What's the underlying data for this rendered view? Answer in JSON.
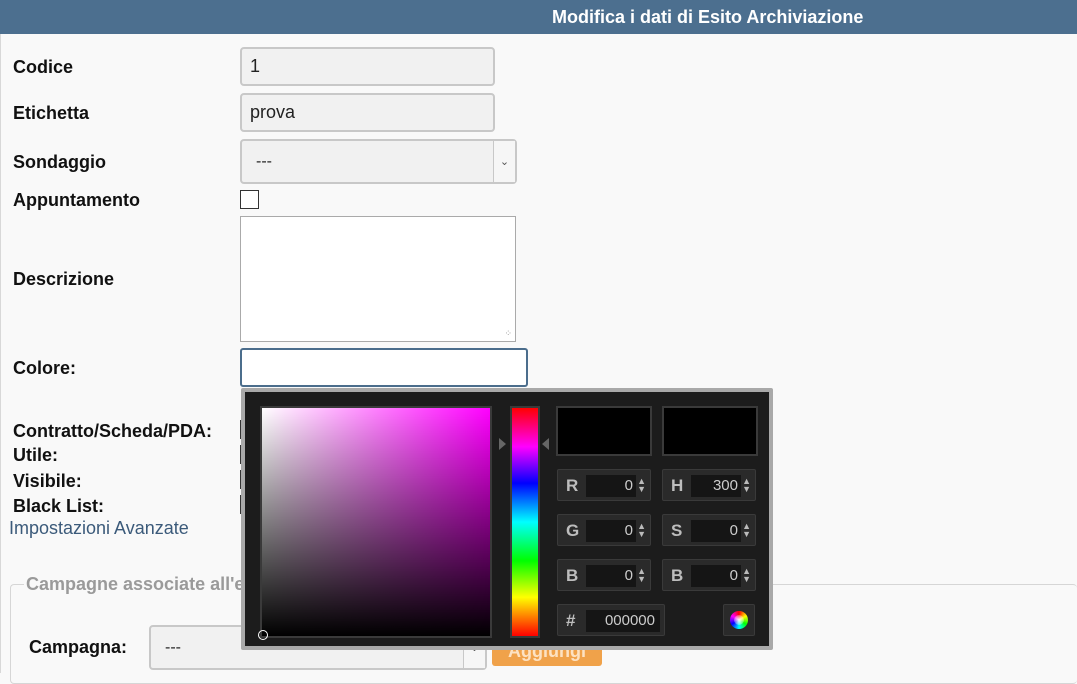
{
  "header": {
    "title": "Modifica i dati di Esito Archiviazione"
  },
  "form": {
    "codice": {
      "label": "Codice",
      "value": "1"
    },
    "etichetta": {
      "label": "Etichetta",
      "value": "prova"
    },
    "sondaggio": {
      "label": "Sondaggio",
      "selected": "---"
    },
    "appuntamento": {
      "label": "Appuntamento",
      "checked": false
    },
    "descrizione": {
      "label": "Descrizione",
      "value": ""
    },
    "colore": {
      "label": "Colore:",
      "value": ""
    },
    "contratto": {
      "label": "Contratto/Scheda/PDA:"
    },
    "utile": {
      "label": "Utile:"
    },
    "visibile": {
      "label": "Visibile:"
    },
    "black_list": {
      "label": "Black List:"
    }
  },
  "advanced_link": "Impostazioni Avanzate",
  "campaigns": {
    "legend": "Campagne associate all'e",
    "campaign_label": "Campagna:",
    "campaign_selected": "---",
    "add_button": "Aggiungi"
  },
  "color_picker": {
    "hue_color": "#ff00ff",
    "current_color": "#000000",
    "r": {
      "label": "R",
      "value": "0"
    },
    "g": {
      "label": "G",
      "value": "0"
    },
    "b": {
      "label": "B",
      "value": "0"
    },
    "h": {
      "label": "H",
      "value": "300"
    },
    "s": {
      "label": "S",
      "value": "0"
    },
    "bv": {
      "label": "B",
      "value": "0"
    },
    "hex": {
      "label": "#",
      "value": "000000"
    }
  },
  "colors": {
    "header_bg": "#4c6f8f",
    "button_orange": "#f0a24a"
  }
}
